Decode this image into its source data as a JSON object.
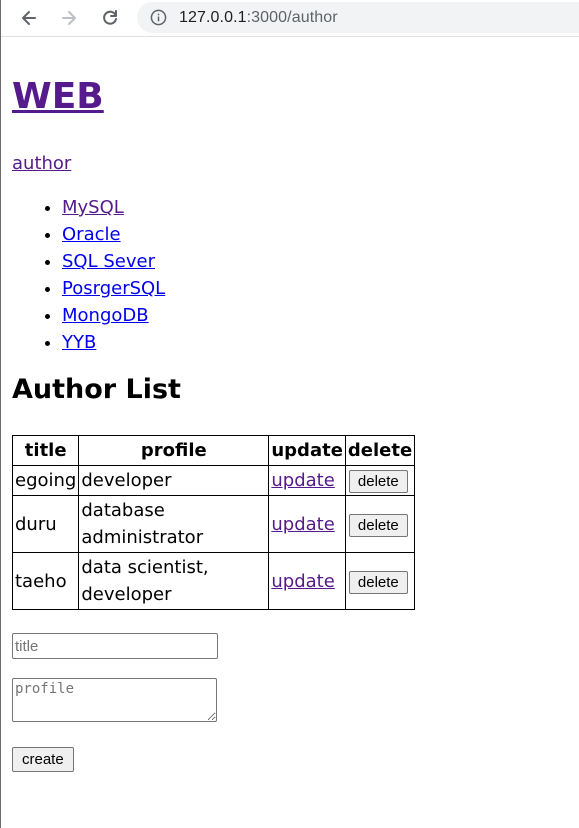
{
  "browser": {
    "url_host": "127.0.0.1",
    "url_rest": ":3000/author"
  },
  "page": {
    "site_title": "WEB",
    "author_link": "author",
    "topics": [
      "MySQL",
      "Oracle",
      "SQL Sever",
      "PosrgerSQL",
      "MongoDB",
      "YYB"
    ],
    "list_heading": "Author List"
  },
  "table": {
    "headers": [
      "title",
      "profile",
      "update",
      "delete"
    ],
    "rows": [
      {
        "title": "egoing",
        "profile_lines": [
          "developer"
        ],
        "update": "update",
        "delete": "delete"
      },
      {
        "title": "duru",
        "profile_lines": [
          "database",
          "administrator"
        ],
        "update": "update",
        "delete": "delete"
      },
      {
        "title": "taeho",
        "profile_lines": [
          "data scientist,",
          "developer"
        ],
        "update": "update",
        "delete": "delete"
      }
    ]
  },
  "form": {
    "title_placeholder": "title",
    "profile_placeholder": "profile",
    "create_label": "create"
  }
}
